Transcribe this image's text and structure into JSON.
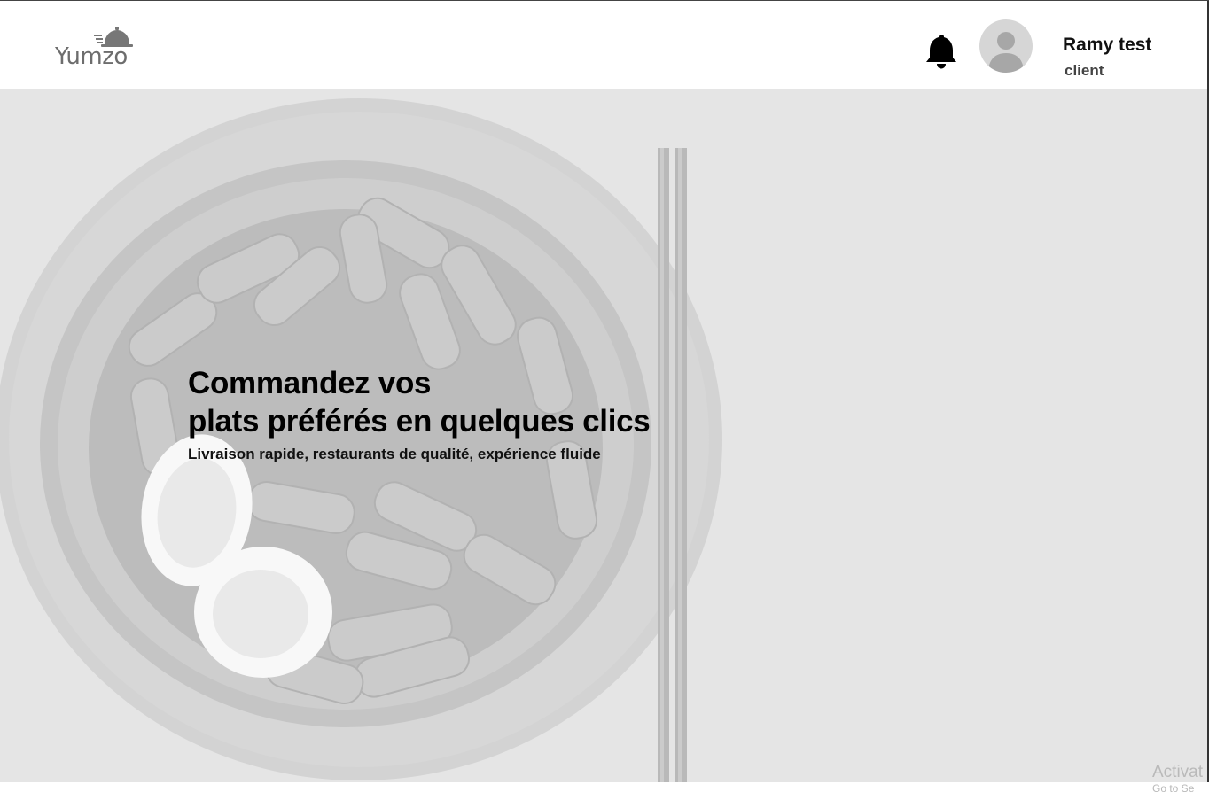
{
  "app": {
    "brand_name": "Yumzo",
    "logo_icon": "cloche-icon"
  },
  "header": {
    "notification_icon": "bell-icon",
    "avatar_icon": "user-avatar-icon",
    "user_name": "Ramy test",
    "user_role": "client"
  },
  "hero": {
    "title_line1": "Commandez vos",
    "title_line2": "plats préférés en quelques clics",
    "subtitle": "Livraison rapide, restaurants de qualité, expérience fluide",
    "background_image": "food-bowl-image"
  },
  "system": {
    "watermark_line1": "Activat",
    "watermark_line2": "Go to Se"
  },
  "colors": {
    "header_bg": "#ffffff",
    "hero_overlay": "#e1e1e1",
    "logo_gray": "#6d6d6d",
    "text_primary": "#000000"
  }
}
